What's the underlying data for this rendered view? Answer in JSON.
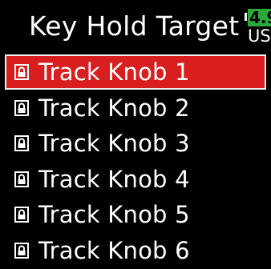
{
  "header": {
    "title": "Key Hold Target",
    "battery_level": "4.9",
    "battery_source": "USB",
    "battery_color": "#2aaa3a"
  },
  "accent_color": "#d81e1e",
  "list": {
    "selected_index": 0,
    "items": [
      {
        "label": "Track Knob 1",
        "icon": "lock-icon"
      },
      {
        "label": "Track Knob 2",
        "icon": "lock-icon"
      },
      {
        "label": "Track Knob 3",
        "icon": "lock-icon"
      },
      {
        "label": "Track Knob 4",
        "icon": "lock-icon"
      },
      {
        "label": "Track Knob 5",
        "icon": "lock-icon"
      },
      {
        "label": "Track Knob 6",
        "icon": "lock-icon"
      }
    ]
  }
}
